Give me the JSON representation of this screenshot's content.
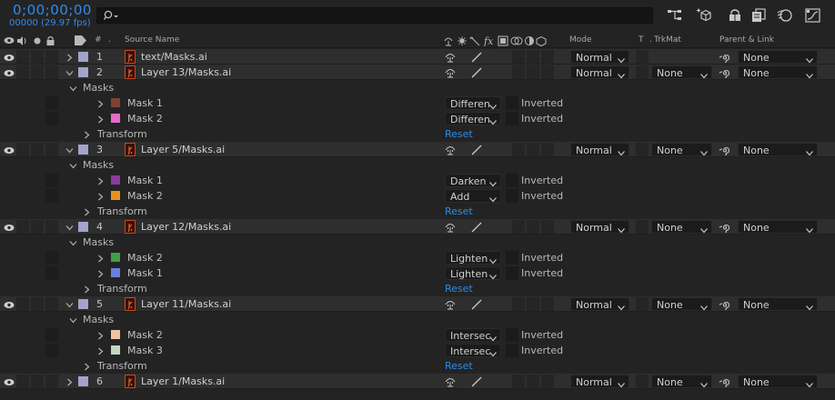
{
  "topbar": {
    "timecode": "0;00;00;00",
    "fps": "00000 (29.97 fps)",
    "search_placeholder": "",
    "icons": [
      "composition-flowchart-icon",
      "draft-3d-icon",
      "shy-layers-icon",
      "frame-blending-icon",
      "motion-blur-icon",
      "graph-editor-icon"
    ]
  },
  "header": {
    "hash": "#",
    "source_name": "Source Name",
    "mode": "Mode",
    "t": "T",
    "trkmat": "TrkMat",
    "parent": "Parent & Link"
  },
  "layers": [
    {
      "num": "1",
      "name": "text/Masks.ai",
      "mode": "Normal",
      "trkmat": "",
      "parent": "None",
      "expanded": false
    },
    {
      "num": "2",
      "name": "Layer 13/Masks.ai",
      "mode": "Normal",
      "trkmat": "None",
      "parent": "None",
      "expanded": true,
      "masks_label": "Masks",
      "masks": [
        {
          "name": "Mask 1",
          "color": "#7a4331",
          "mode": "Differen",
          "inverted": "Inverted"
        },
        {
          "name": "Mask 2",
          "color": "#e66bc8",
          "mode": "Differen",
          "inverted": "Inverted"
        }
      ],
      "transform_label": "Transform",
      "reset": "Reset"
    },
    {
      "num": "3",
      "name": "Layer 5/Masks.ai",
      "mode": "Normal",
      "trkmat": "None",
      "parent": "None",
      "expanded": true,
      "masks_label": "Masks",
      "masks": [
        {
          "name": "Mask 1",
          "color": "#8c3a9c",
          "mode": "Darken",
          "inverted": "Inverted"
        },
        {
          "name": "Mask 2",
          "color": "#e8921e",
          "mode": "Add",
          "inverted": "Inverted"
        }
      ],
      "transform_label": "Transform",
      "reset": "Reset"
    },
    {
      "num": "4",
      "name": "Layer 12/Masks.ai",
      "mode": "Normal",
      "trkmat": "None",
      "parent": "None",
      "expanded": true,
      "masks_label": "Masks",
      "masks": [
        {
          "name": "Mask 2",
          "color": "#3fa048",
          "mode": "Lighten",
          "inverted": "Inverted"
        },
        {
          "name": "Mask 1",
          "color": "#6b7ee0",
          "mode": "Lighten",
          "inverted": "Inverted"
        }
      ],
      "transform_label": "Transform",
      "reset": "Reset"
    },
    {
      "num": "5",
      "name": "Layer 11/Masks.ai",
      "mode": "Normal",
      "trkmat": "None",
      "parent": "None",
      "expanded": true,
      "masks_label": "Masks",
      "masks": [
        {
          "name": "Mask 2",
          "color": "#eec3a0",
          "mode": "Intersec",
          "inverted": "Inverted"
        },
        {
          "name": "Mask 3",
          "color": "#c0d8c0",
          "mode": "Intersec",
          "inverted": "Inverted"
        }
      ],
      "transform_label": "Transform",
      "reset": "Reset"
    },
    {
      "num": "6",
      "name": "Layer 1/Masks.ai",
      "mode": "Normal",
      "trkmat": "None",
      "parent": "None",
      "expanded": false
    }
  ],
  "colors": {
    "accent": "#2d8ceb",
    "layer_label": "#a3a3cc",
    "ai_icon": "#c84b1a"
  }
}
